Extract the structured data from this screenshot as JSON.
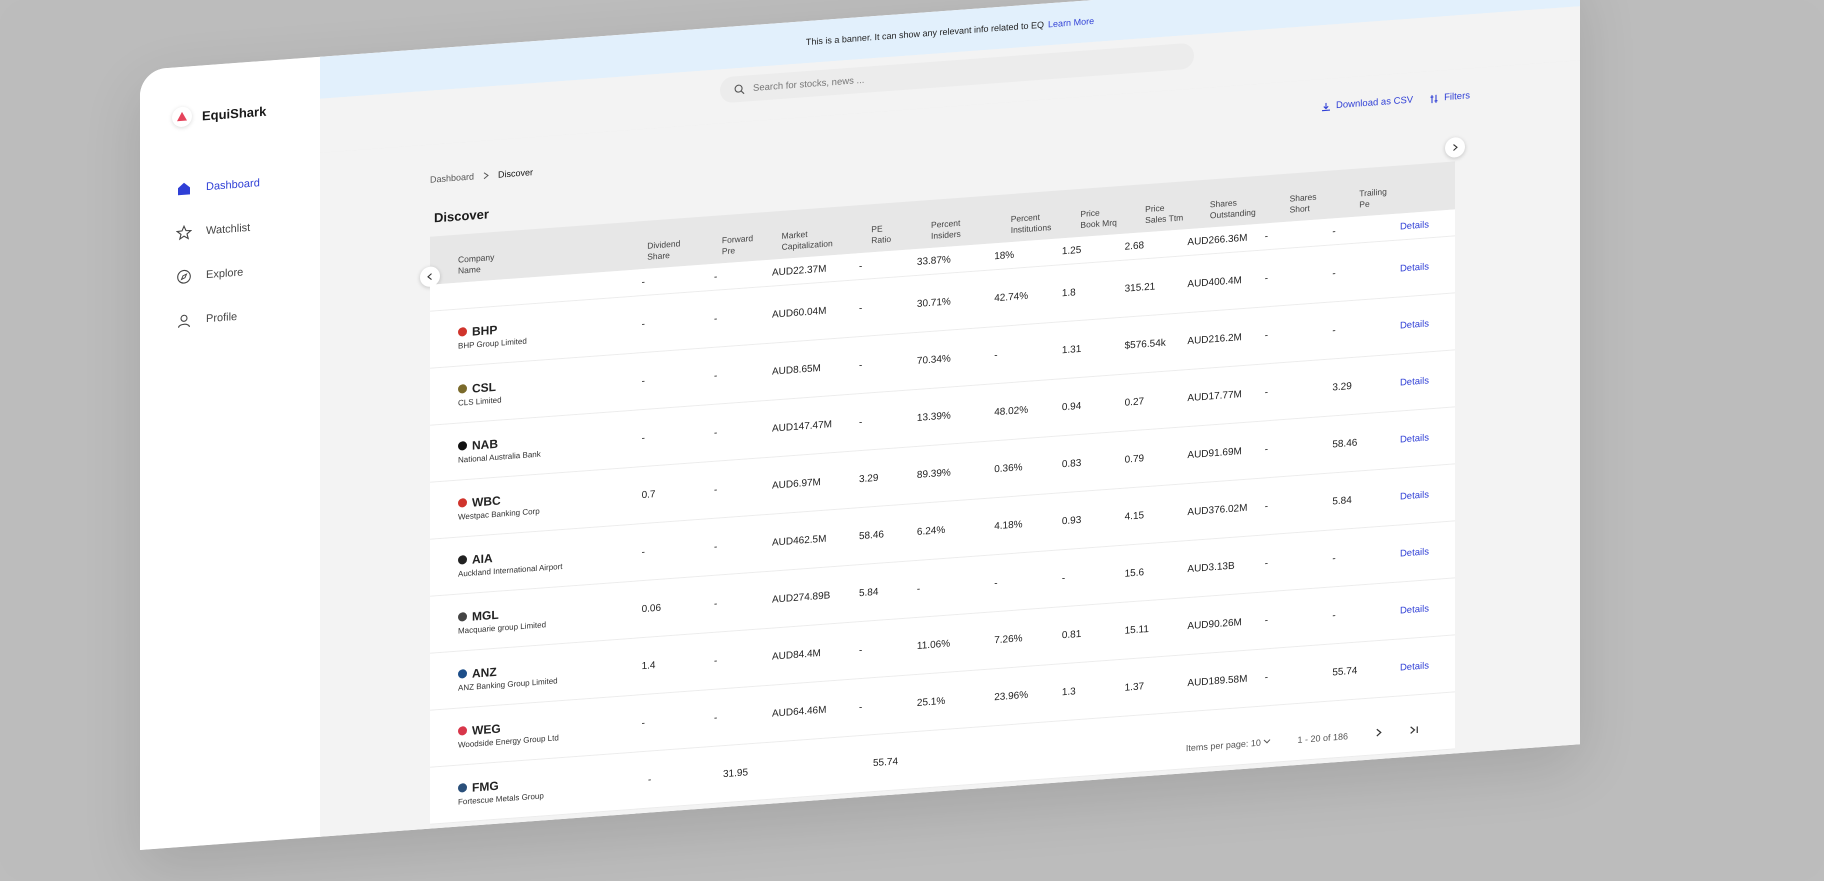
{
  "brand": {
    "name": "EquiShark"
  },
  "sidebar": {
    "items": [
      {
        "label": "Dashboard",
        "icon": "home-icon",
        "active": true
      },
      {
        "label": "Watchlist",
        "icon": "star-icon",
        "active": false
      },
      {
        "label": "Explore",
        "icon": "compass-icon",
        "active": false
      },
      {
        "label": "Profile",
        "icon": "user-icon",
        "active": false
      }
    ]
  },
  "banner": {
    "text": "This is a banner. It can show any relevant info related to EQ",
    "link": "Learn More"
  },
  "search": {
    "placeholder": "Search for stocks, news ..."
  },
  "breadcrumb": {
    "parent": "Dashboard",
    "current": "Discover"
  },
  "actions": {
    "download": "Download as CSV",
    "filters": "Filters"
  },
  "page": {
    "title": "Discover"
  },
  "table": {
    "headers": [
      "Company Name",
      "Dividend Share",
      "Forward Pre",
      "Market Capitalization",
      "PE Ratio",
      "Percent Insiders",
      "Percent Institutions",
      "Price Book Mrq",
      "Price Sales Ttm",
      "Shares Outstanding",
      "Shares Short",
      "Trailing Pe"
    ],
    "header_lines": [
      [
        "Company",
        "Name"
      ],
      [
        "Dividend",
        "Share"
      ],
      [
        "Forward",
        "Pre"
      ],
      [
        "Market",
        "Capitalization"
      ],
      [
        "PE",
        "Ratio"
      ],
      [
        "Percent",
        "Insiders"
      ],
      [
        "Percent",
        "Institutions"
      ],
      [
        "Price",
        "Book Mrq"
      ],
      [
        "Price",
        "Sales Ttm"
      ],
      [
        "Shares",
        "Outstanding"
      ],
      [
        "Shares",
        "Short"
      ],
      [
        "Trailing",
        "Pe"
      ]
    ],
    "first_row_values": [
      "-",
      "-",
      "AUD22.37M",
      "-",
      "33.87%",
      "18%",
      "1.25",
      "2.68",
      "AUD266.36M",
      "-",
      "-"
    ],
    "details_label": "Details",
    "rows": [
      {
        "ticker": "BHP",
        "name": "BHP Group Limited",
        "logo": "#d0342c",
        "v": [
          "-",
          "-",
          "AUD60.04M",
          "-",
          "30.71%",
          "42.74%",
          "1.8",
          "315.21",
          "AUD400.4M",
          "-",
          "-"
        ]
      },
      {
        "ticker": "CSL",
        "name": "CLS Limited",
        "logo": "#7a6a2b",
        "v": [
          "-",
          "-",
          "AUD8.65M",
          "-",
          "70.34%",
          "-",
          "1.31",
          "$576.54k",
          "AUD216.2M",
          "-",
          "-"
        ]
      },
      {
        "ticker": "NAB",
        "name": "National Australia Bank",
        "logo": "#111111",
        "v": [
          "-",
          "-",
          "AUD147.47M",
          "-",
          "13.39%",
          "48.02%",
          "0.94",
          "0.27",
          "AUD17.77M",
          "-",
          "3.29"
        ]
      },
      {
        "ticker": "WBC",
        "name": "Westpac Banking Corp",
        "logo": "#d0342c",
        "v": [
          "0.7",
          "-",
          "AUD6.97M",
          "3.29",
          "89.39%",
          "0.36%",
          "0.83",
          "0.79",
          "AUD91.69M",
          "-",
          "58.46"
        ]
      },
      {
        "ticker": "AIA",
        "name": "Auckland International Airport",
        "logo": "#222222",
        "v": [
          "-",
          "-",
          "AUD462.5M",
          "58.46",
          "6.24%",
          "4.18%",
          "0.93",
          "4.15",
          "AUD376.02M",
          "-",
          "5.84"
        ]
      },
      {
        "ticker": "MGL",
        "name": "Macquarie group Limited",
        "logo": "#444444",
        "v": [
          "0.06",
          "-",
          "AUD274.89B",
          "5.84",
          "-",
          "-",
          "-",
          "15.6",
          "AUD3.13B",
          "-",
          "-"
        ]
      },
      {
        "ticker": "ANZ",
        "name": "ANZ Banking Group Limited",
        "logo": "#1d4e89",
        "v": [
          "1.4",
          "-",
          "AUD84.4M",
          "-",
          "11.06%",
          "7.26%",
          "0.81",
          "15.11",
          "AUD90.26M",
          "-",
          "-"
        ]
      },
      {
        "ticker": "WEG",
        "name": "Woodside Energy Group Ltd",
        "logo": "#d8364a",
        "v": [
          "-",
          "-",
          "AUD64.46M",
          "-",
          "25.1%",
          "23.96%",
          "1.3",
          "1.37",
          "AUD189.58M",
          "-",
          "55.74"
        ]
      },
      {
        "ticker": "FMG",
        "name": "Fortescue Metals Group",
        "logo": "#2a4f7a",
        "v": [
          "-",
          "31.95",
          "",
          "55.74",
          "",
          "",
          "",
          "",
          "",
          "",
          ""
        ]
      }
    ]
  },
  "pager": {
    "items_per_page": "Items per page: 10",
    "range": "1 - 20 of 186"
  }
}
